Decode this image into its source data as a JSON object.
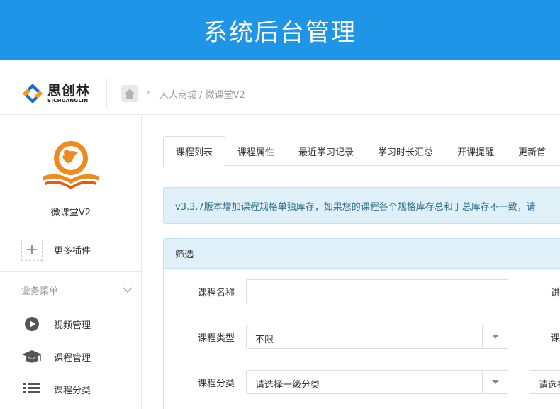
{
  "banner": {
    "title": "系统后台管理"
  },
  "brand": {
    "name_cn": "思创林",
    "name_en": "SICHUANGLIN"
  },
  "breadcrumb": {
    "path": "人人商城 / 微课堂V2"
  },
  "sidebar": {
    "app_name": "微课堂V2",
    "more_plugins": "更多插件",
    "menu_title": "业务菜单",
    "items": [
      {
        "label": "视频管理",
        "icon": "play-circle-icon"
      },
      {
        "label": "课程管理",
        "icon": "graduation-cap-icon"
      },
      {
        "label": "课程分类",
        "icon": "list-icon"
      }
    ]
  },
  "tabs": [
    {
      "label": "课程列表",
      "active": true
    },
    {
      "label": "课程属性"
    },
    {
      "label": "最近学习记录"
    },
    {
      "label": "学习时长汇总"
    },
    {
      "label": "开课提醒"
    },
    {
      "label": "更新首"
    }
  ],
  "notice": "v3.3.7版本增加课程规格单独库存，如果您的课程各个规格库存总和于总库存不一致，请",
  "filter": {
    "title": "筛选",
    "course_name_label": "课程名称",
    "course_name_value": "",
    "right_label_1": "讲",
    "course_type_label": "课程类型",
    "course_type_value": "不限",
    "right_label_2": "课",
    "category_label": "课程分类",
    "category_value": "请选择一级分类",
    "category2_value": "请选择"
  },
  "colors": {
    "banner": "#1e95e6",
    "notice_bg": "#dff0f8",
    "accent_orange": "#f08a1c"
  }
}
